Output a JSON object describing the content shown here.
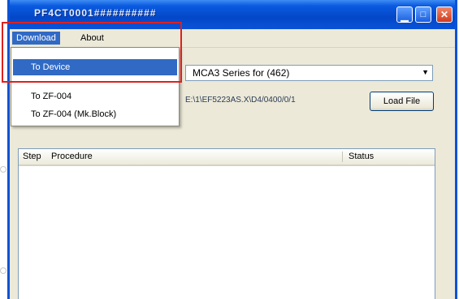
{
  "window": {
    "title": "PF4CT0001##########",
    "controls": {
      "minimize": "▁",
      "maximize": "□",
      "close": "✕"
    }
  },
  "menubar": {
    "items": [
      {
        "label": "Download",
        "active": true
      },
      {
        "label": "About",
        "active": false
      }
    ]
  },
  "dropdown": {
    "items": [
      {
        "label": "To Device",
        "selected": true
      },
      {
        "label": "To ZF-004",
        "selected": false
      },
      {
        "label": "To ZF-004 (Mk.Block)",
        "selected": false
      }
    ]
  },
  "device_select": {
    "value": "MCA3 Series for (462)"
  },
  "file": {
    "path": "E:\\1\\EF5223AS.X\\D4/0400/0/1",
    "load_label": "Load File"
  },
  "listview": {
    "columns": [
      "Step",
      "Procedure",
      "Status"
    ]
  },
  "colors": {
    "titlebar": "#0a53d6",
    "selection": "#316ac5",
    "highlight_box": "#e0201c"
  }
}
